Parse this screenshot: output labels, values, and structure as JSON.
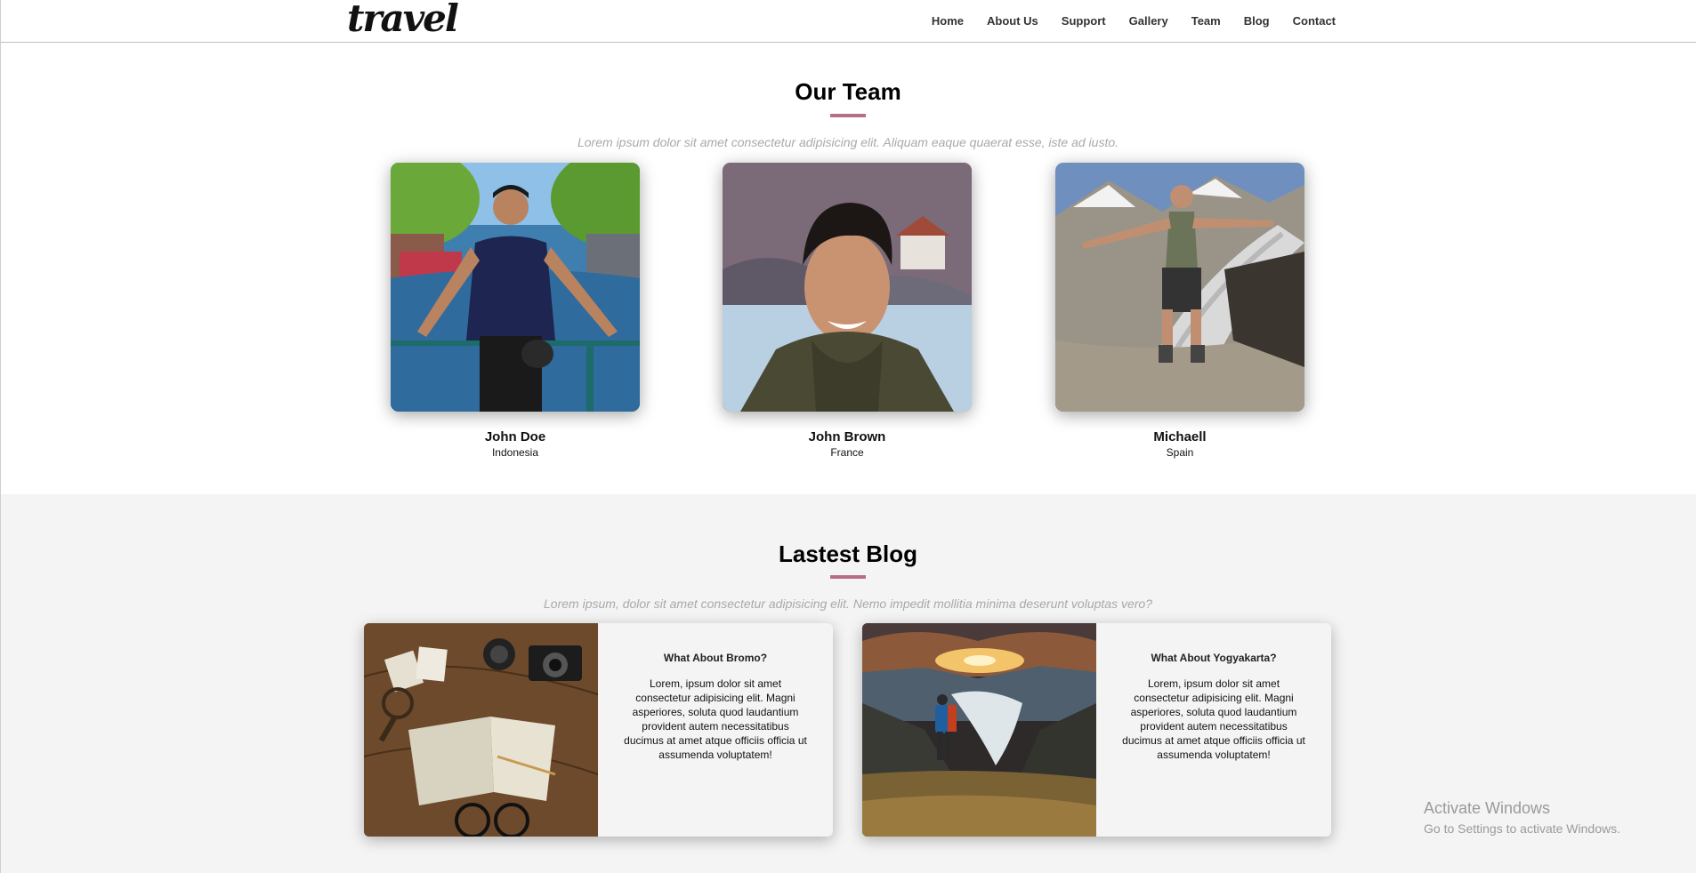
{
  "header": {
    "logo": "travel",
    "nav": [
      "Home",
      "About Us",
      "Support",
      "Gallery",
      "Team",
      "Blog",
      "Contact"
    ]
  },
  "team": {
    "title": "Our Team",
    "subtitle": "Lorem ipsum dolor sit amet consectetur adipisicing elit. Aliquam eaque quaerat esse, iste ad iusto.",
    "members": [
      {
        "name": "John Doe",
        "country": "Indonesia"
      },
      {
        "name": "John Brown",
        "country": "France"
      },
      {
        "name": "Michaell",
        "country": "Spain"
      }
    ]
  },
  "blog": {
    "title": "Lastest Blog",
    "subtitle": "Lorem ipsum, dolor sit amet consectetur adipisicing elit. Nemo impedit mollitia minima deserunt voluptas vero?",
    "posts": [
      {
        "title": "What About Bromo?",
        "text": "Lorem, ipsum dolor sit amet consectetur adipisicing elit. Magni asperiores, soluta quod laudantium provident autem necessitatibus ducimus at amet atque officiis officia ut assumenda voluptatem!"
      },
      {
        "title": "What About Yogyakarta?",
        "text": "Lorem, ipsum dolor sit amet consectetur adipisicing elit. Magni asperiores, soluta quod laudantium provident autem necessitatibus ducimus at amet atque officiis officia ut assumenda voluptatem!"
      }
    ]
  },
  "watermark": {
    "line1": "Activate Windows",
    "line2": "Go to Settings to activate Windows."
  },
  "colors": {
    "accent": "#b56f8a",
    "blog_bg": "#f4f4f4",
    "subtitle": "#a9a9a9"
  }
}
